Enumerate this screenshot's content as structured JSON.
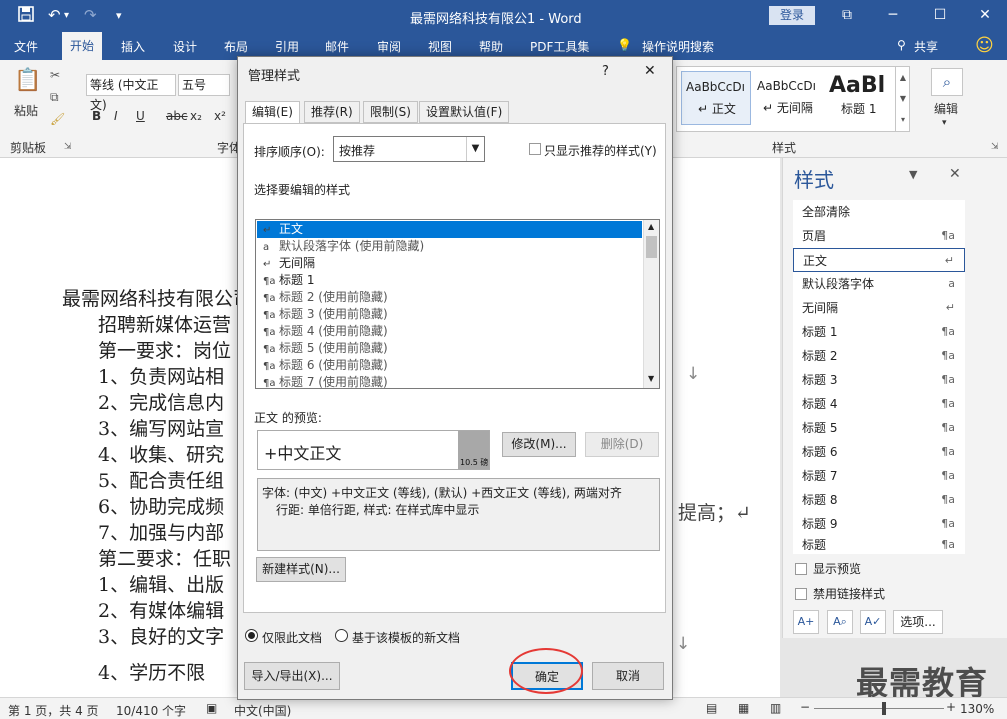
{
  "titlebar": {
    "doc_title": "最需网络科技有限公1 - Word",
    "login": "登录",
    "save_icon": "save-icon",
    "undo": "↶",
    "redo": "↷",
    "customize": "▾",
    "restore": "⧉",
    "minimize": "─",
    "maximize": "☐",
    "close": "✕"
  },
  "tabs": [
    "文件",
    "开始",
    "插入",
    "设计",
    "布局",
    "引用",
    "邮件",
    "审阅",
    "视图",
    "帮助",
    "PDF工具集"
  ],
  "tell_me": "操作说明搜索",
  "share": "共享",
  "ribbon": {
    "paste": "粘贴",
    "clipboard": "剪贴板",
    "font_name": "等线 (中文正文)",
    "font_size": "五号",
    "font_group": "字体",
    "bold": "B",
    "italic": "I",
    "underline": "U",
    "strike": "abc",
    "sub": "x₂",
    "sup": "x²",
    "styles_group": "样式",
    "edit": "编辑",
    "style_cards": [
      {
        "sample": "AaBbCcDı",
        "name": "↵ 正文"
      },
      {
        "sample": "AaBbCcDı",
        "name": "↵ 无间隔"
      },
      {
        "sample": "AaBl",
        "name": "标题 1"
      }
    ]
  },
  "document": {
    "lines": [
      "最需网络科技有限公司",
      "招聘新媒体运营",
      "第一要求：岗位",
      "1、负责网站相",
      "2、完成信息内",
      "3、编写网站宣",
      "4、收集、研究",
      "5、配合责任组",
      "6、协助完成频",
      "7、加强与内部",
      "第二要求：任职",
      "1、编辑、出版",
      "2、有媒体编辑",
      "3、良好的文字",
      "4、学历不限"
    ],
    "tail_text": "提高；↵",
    "para_mark": "↓"
  },
  "styles_pane": {
    "title": "样式",
    "items": [
      {
        "name": "全部清除",
        "sym": ""
      },
      {
        "name": "页眉",
        "sym": "¶a"
      },
      {
        "name": "正文",
        "sym": "↵"
      },
      {
        "name": "默认段落字体",
        "sym": "a"
      },
      {
        "name": "无间隔",
        "sym": "↵"
      },
      {
        "name": "标题 1",
        "sym": "¶a"
      },
      {
        "name": "标题 2",
        "sym": "¶a"
      },
      {
        "name": "标题 3",
        "sym": "¶a"
      },
      {
        "name": "标题 4",
        "sym": "¶a"
      },
      {
        "name": "标题 5",
        "sym": "¶a"
      },
      {
        "name": "标题 6",
        "sym": "¶a"
      },
      {
        "name": "标题 7",
        "sym": "¶a"
      },
      {
        "name": "标题 8",
        "sym": "¶a"
      },
      {
        "name": "标题 9",
        "sym": "¶a"
      },
      {
        "name": "标题",
        "sym": "¶a"
      }
    ],
    "show_preview": "显示预览",
    "disable_linked": "禁用链接样式",
    "options": "选项..."
  },
  "dialog": {
    "title": "管理样式",
    "help": "?",
    "close": "✕",
    "tabs": [
      "编辑(E)",
      "推荐(R)",
      "限制(S)",
      "设置默认值(F)"
    ],
    "sort_label": "排序顺序(O):",
    "sort_value": "按推荐",
    "only_recommended": "只显示推荐的样式(Y)",
    "select_label": "选择要编辑的样式",
    "style_list": [
      {
        "glyph": "↵",
        "name": "正文",
        "hidden": false
      },
      {
        "glyph": "a",
        "name": "默认段落字体 (使用前隐藏)",
        "hidden": true
      },
      {
        "glyph": "↵",
        "name": "无间隔",
        "hidden": false
      },
      {
        "glyph": "¶a",
        "name": "标题 1",
        "hidden": false
      },
      {
        "glyph": "¶a",
        "name": "标题 2 (使用前隐藏)",
        "hidden": true
      },
      {
        "glyph": "¶a",
        "name": "标题 3 (使用前隐藏)",
        "hidden": true
      },
      {
        "glyph": "¶a",
        "name": "标题 4 (使用前隐藏)",
        "hidden": true
      },
      {
        "glyph": "¶a",
        "name": "标题 5 (使用前隐藏)",
        "hidden": true
      },
      {
        "glyph": "¶a",
        "name": "标题 6 (使用前隐藏)",
        "hidden": true
      },
      {
        "glyph": "¶a",
        "name": "标题 7 (使用前隐藏)",
        "hidden": true
      }
    ],
    "preview_label": "正文 的预览:",
    "preview_text": "+中文正文",
    "preview_size": "10.5 磅",
    "modify": "修改(M)...",
    "delete": "删除(D)",
    "desc_line1": "字体: (中文) +中文正文 (等线), (默认) +西文正文 (等线), 两端对齐",
    "desc_line2": "行距: 单倍行距, 样式: 在样式库中显示",
    "new_style": "新建样式(N)...",
    "only_doc": "仅限此文档",
    "new_template": "基于该模板的新文档",
    "import_export": "导入/导出(X)...",
    "ok": "确定",
    "cancel": "取消"
  },
  "statusbar": {
    "page": "第 1 页，共 4 页",
    "words": "10/410 个字",
    "lang": "中文(中国)",
    "zoom": "130%"
  },
  "watermark": "最需教育"
}
